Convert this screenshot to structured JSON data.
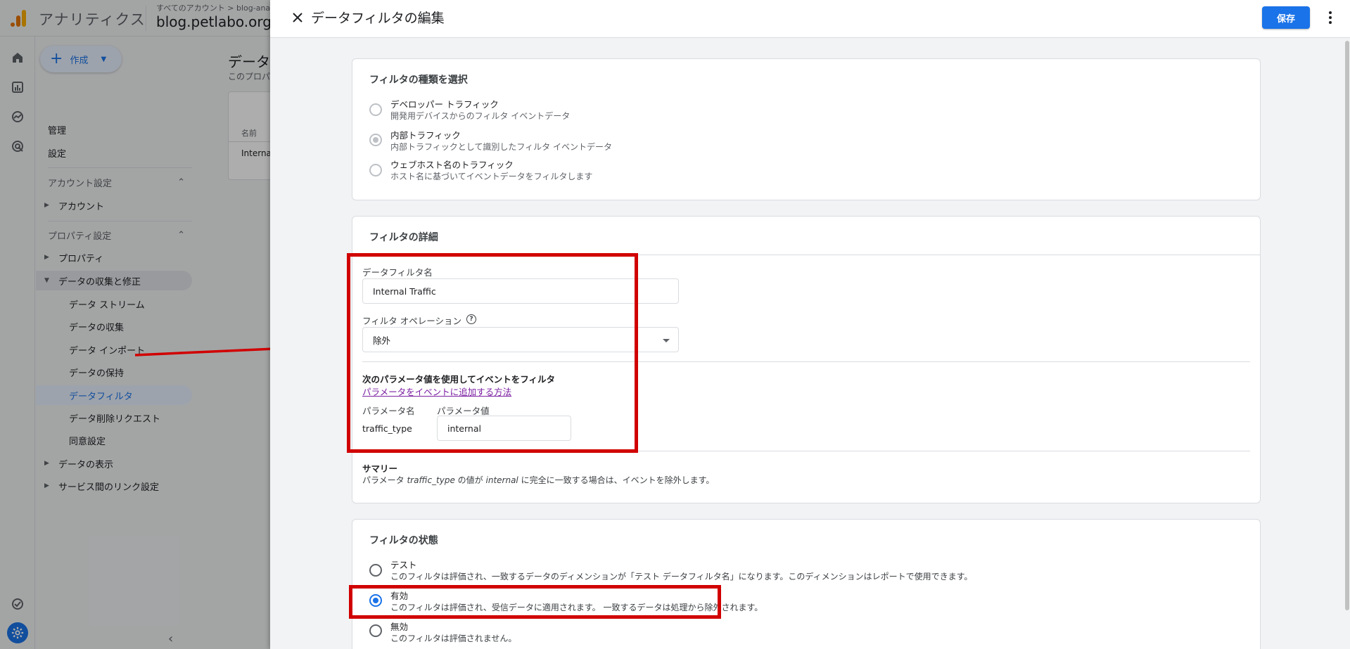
{
  "app": {
    "name": "アナリティクス",
    "breadcrumb": "すべてのアカウント > blog-analy",
    "property": "blog.petlabo.org"
  },
  "nav": {
    "create_label": "作成",
    "admin": "管理",
    "settings": "設定",
    "account_settings": "アカウント設定",
    "account": "アカウント",
    "property_settings": "プロパティ設定",
    "property": "プロパティ",
    "data_collection_mod": "データの収集と修正",
    "data_streams": "データ ストリーム",
    "data_collection": "データの収集",
    "data_import": "データ インポート",
    "data_retention": "データの保持",
    "data_filters": "データフィルタ",
    "data_deletion": "データ削除リクエスト",
    "consent": "同意設定",
    "data_display": "データの表示",
    "product_links": "サービス間のリンク設定"
  },
  "background_page": {
    "title": "データ",
    "subtitle": "このプロパ",
    "col_name": "名前",
    "row_name": "Interna"
  },
  "drawer": {
    "title": "データフィルタの編集",
    "save_label": "保存",
    "type_card": {
      "title": "フィルタの種類を選択",
      "options": [
        {
          "label": "デベロッパー トラフィック",
          "desc": "開発用デバイスからのフィルタ イベントデータ"
        },
        {
          "label": "内部トラフィック",
          "desc": "内部トラフィックとして識別したフィルタ イベントデータ"
        },
        {
          "label": "ウェブホスト名のトラフィック",
          "desc": "ホスト名に基づいてイベントデータをフィルタします"
        }
      ]
    },
    "details_card": {
      "title": "フィルタの詳細",
      "name_label": "データフィルタ名",
      "name_value": "Internal Traffic",
      "operation_label": "フィルタ オペレーション",
      "operation_value": "除外",
      "param_heading": "次のパラメータ値を使用してイベントをフィルタ",
      "param_link": "パラメータをイベントに追加する方法",
      "param_name_label": "パラメータ名",
      "param_value_label": "パラメータ値",
      "param_name": "traffic_type",
      "param_value": "internal",
      "summary_title": "サマリー",
      "summary_pre": "パラメータ ",
      "summary_param": "traffic_type",
      "summary_mid": " の値が ",
      "summary_value": "internal",
      "summary_post": " に完全に一致する場合は、イベントを除外します。"
    },
    "state_card": {
      "title": "フィルタの状態",
      "options": [
        {
          "label": "テスト",
          "desc": "このフィルタは評価され、一致するデータのディメンションが「テスト データフィルタ名」になります。このディメンションはレポートで使用できます。"
        },
        {
          "label": "有効",
          "desc": "このフィルタは評価され、受信データに適用されます。 一致するデータは処理から除外されます。"
        },
        {
          "label": "無効",
          "desc": "このフィルタは評価されません。"
        }
      ]
    }
  },
  "colors": {
    "accent": "#1a73e8",
    "highlight": "#d10000"
  }
}
